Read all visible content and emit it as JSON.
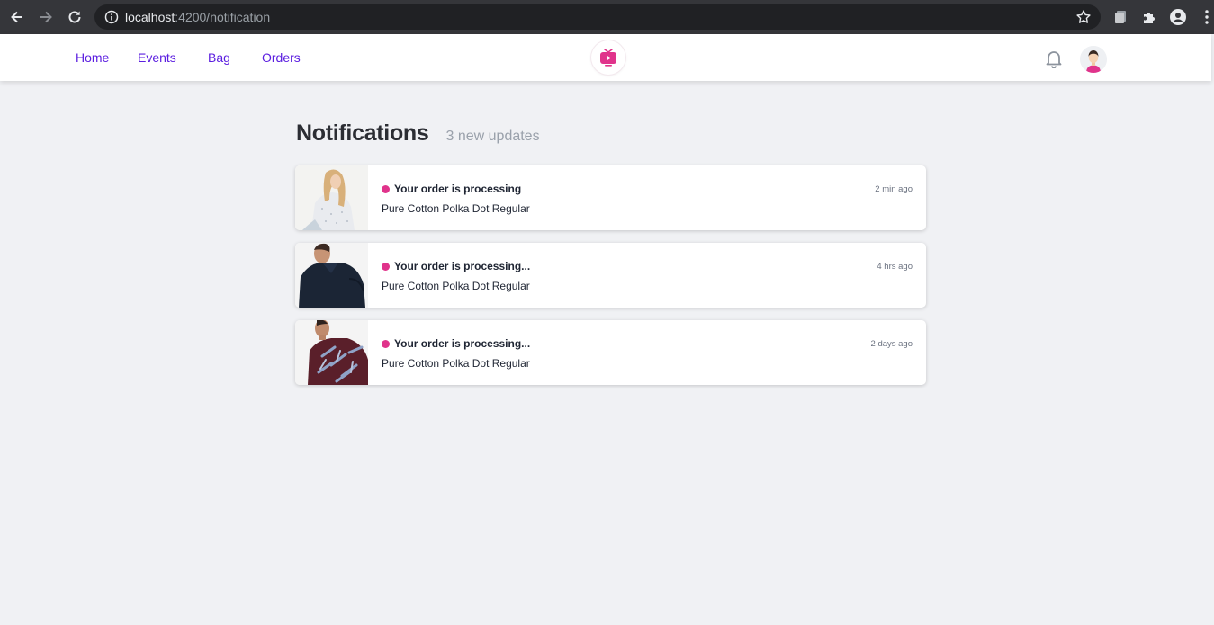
{
  "browser": {
    "url_host": "localhost",
    "url_rest": ":4200/notification"
  },
  "nav": {
    "links": [
      {
        "label": "Home"
      },
      {
        "label": "Events"
      },
      {
        "label": "Bag"
      },
      {
        "label": "Orders"
      }
    ],
    "logo_icon": "tv-play-icon",
    "bell_icon": "bell-icon",
    "avatar_icon": "user-avatar"
  },
  "page": {
    "title": "Notifications",
    "subtitle": "3 new updates"
  },
  "notifications": [
    {
      "title": "Your order is processing",
      "description": "Pure Cotton Polka Dot Regular",
      "time": "2 min ago",
      "unread": true
    },
    {
      "title": "Your order is processing...",
      "description": "Pure Cotton Polka Dot Regular",
      "time": "4 hrs ago",
      "unread": true
    },
    {
      "title": "Your order is processing...",
      "description": "Pure Cotton Polka Dot Regular",
      "time": "2 days ago",
      "unread": true
    }
  ],
  "colors": {
    "accent": "#e0338b",
    "nav_link": "#5b1ee0",
    "background": "#f0f1f4"
  }
}
